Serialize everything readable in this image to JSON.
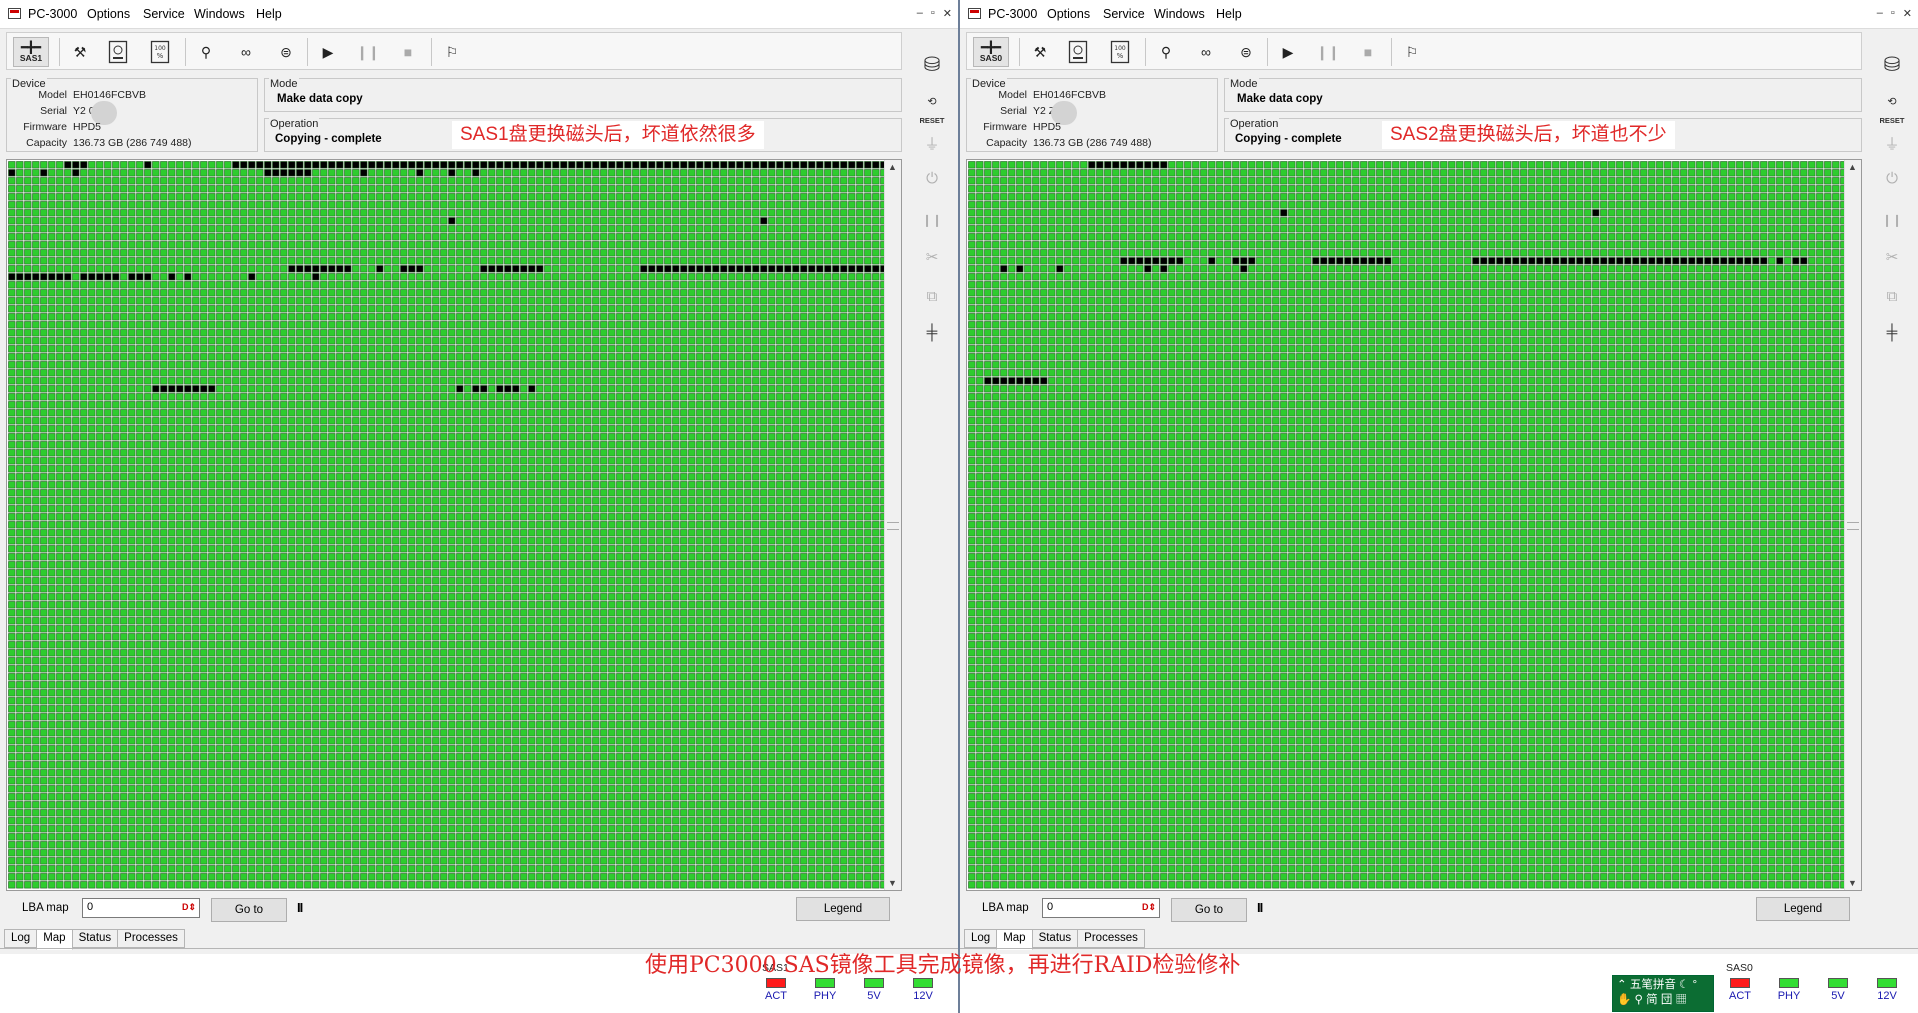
{
  "colors": {
    "ok_block": "#2ecc2e",
    "bad_block": "#000000",
    "annotation": "#e02828",
    "led_red": "#ff1a1a",
    "led_green": "#33dd33"
  },
  "panes": [
    {
      "menu": {
        "title": "PC-3000",
        "items": [
          "Options",
          "Service",
          "Windows",
          "Help"
        ]
      },
      "window_controls": [
        "–",
        "▫",
        "✕"
      ],
      "toolbar": {
        "device_tab": "SAS1",
        "icons": [
          "tools-icon",
          "hdd-info-icon",
          "percent-icon",
          "probe-icon",
          "binoculars-icon",
          "disk-copy-icon",
          "play-icon",
          "pause-icon",
          "stop-icon",
          "exit-icon"
        ]
      },
      "device": {
        "group_label": "Device",
        "model_label": "Model",
        "model": "EH0146FCBVB",
        "serial_label": "Serial",
        "serial": "Y2     0U",
        "firmware_label": "Firmware",
        "firmware": "HPD5",
        "capacity_label": "Capacity",
        "capacity": "136.73 GB (286 749 488)"
      },
      "mode": {
        "group_label": "Mode",
        "value": "Make data copy"
      },
      "operation": {
        "group_label": "Operation",
        "value": "Copying - complete"
      },
      "annotation": "SAS1盘更换磁头后，坏道依然很多",
      "map_bad_blocks": [
        [
          0,
          7
        ],
        [
          0,
          8
        ],
        [
          0,
          9
        ],
        [
          0,
          17
        ],
        [
          0,
          28
        ],
        [
          0,
          29
        ],
        [
          0,
          30
        ],
        [
          0,
          31
        ],
        [
          0,
          32
        ],
        [
          0,
          33
        ],
        [
          0,
          34
        ],
        [
          0,
          35
        ],
        [
          0,
          36
        ],
        [
          0,
          37
        ],
        [
          0,
          38
        ],
        [
          0,
          39
        ],
        [
          0,
          40
        ],
        [
          0,
          41
        ],
        [
          0,
          42
        ],
        [
          0,
          43
        ],
        [
          0,
          44
        ],
        [
          0,
          45
        ],
        [
          0,
          46
        ],
        [
          0,
          47
        ],
        [
          0,
          48
        ],
        [
          0,
          49
        ],
        [
          0,
          50
        ],
        [
          0,
          51
        ],
        [
          0,
          52
        ],
        [
          0,
          53
        ],
        [
          0,
          54
        ],
        [
          0,
          55
        ],
        [
          0,
          56
        ],
        [
          0,
          57
        ],
        [
          0,
          58
        ],
        [
          0,
          59
        ],
        [
          0,
          60
        ],
        [
          0,
          61
        ],
        [
          0,
          62
        ],
        [
          0,
          63
        ],
        [
          0,
          64
        ],
        [
          0,
          65
        ],
        [
          0,
          66
        ],
        [
          0,
          67
        ],
        [
          0,
          68
        ],
        [
          0,
          69
        ],
        [
          0,
          70
        ],
        [
          0,
          71
        ],
        [
          0,
          72
        ],
        [
          0,
          73
        ],
        [
          0,
          74
        ],
        [
          0,
          75
        ],
        [
          0,
          76
        ],
        [
          0,
          77
        ],
        [
          0,
          78
        ],
        [
          0,
          79
        ],
        [
          0,
          80
        ],
        [
          0,
          81
        ],
        [
          0,
          82
        ],
        [
          0,
          83
        ],
        [
          0,
          84
        ],
        [
          0,
          85
        ],
        [
          0,
          86
        ],
        [
          0,
          87
        ],
        [
          0,
          88
        ],
        [
          0,
          89
        ],
        [
          0,
          90
        ],
        [
          0,
          91
        ],
        [
          0,
          92
        ],
        [
          0,
          93
        ],
        [
          0,
          94
        ],
        [
          0,
          95
        ],
        [
          0,
          96
        ],
        [
          0,
          97
        ],
        [
          0,
          98
        ],
        [
          0,
          99
        ],
        [
          0,
          100
        ],
        [
          0,
          101
        ],
        [
          0,
          102
        ],
        [
          0,
          103
        ],
        [
          0,
          104
        ],
        [
          0,
          105
        ],
        [
          0,
          106
        ],
        [
          0,
          107
        ],
        [
          0,
          108
        ],
        [
          0,
          109
        ],
        [
          1,
          0
        ],
        [
          1,
          4
        ],
        [
          1,
          8
        ],
        [
          1,
          32
        ],
        [
          1,
          33
        ],
        [
          1,
          34
        ],
        [
          1,
          35
        ],
        [
          1,
          36
        ],
        [
          1,
          37
        ],
        [
          1,
          44
        ],
        [
          1,
          51
        ],
        [
          1,
          55
        ],
        [
          1,
          58
        ],
        [
          7,
          55
        ],
        [
          7,
          94
        ],
        [
          13,
          35
        ],
        [
          13,
          36
        ],
        [
          13,
          37
        ],
        [
          13,
          38
        ],
        [
          13,
          39
        ],
        [
          13,
          40
        ],
        [
          13,
          41
        ],
        [
          13,
          42
        ],
        [
          13,
          46
        ],
        [
          13,
          49
        ],
        [
          13,
          50
        ],
        [
          13,
          51
        ],
        [
          13,
          59
        ],
        [
          13,
          60
        ],
        [
          13,
          61
        ],
        [
          13,
          62
        ],
        [
          13,
          63
        ],
        [
          13,
          64
        ],
        [
          13,
          65
        ],
        [
          13,
          66
        ],
        [
          13,
          79
        ],
        [
          13,
          80
        ],
        [
          13,
          81
        ],
        [
          13,
          82
        ],
        [
          13,
          83
        ],
        [
          13,
          84
        ],
        [
          13,
          85
        ],
        [
          13,
          86
        ],
        [
          13,
          87
        ],
        [
          13,
          88
        ],
        [
          13,
          89
        ],
        [
          13,
          90
        ],
        [
          13,
          91
        ],
        [
          13,
          92
        ],
        [
          13,
          93
        ],
        [
          13,
          94
        ],
        [
          13,
          95
        ],
        [
          13,
          96
        ],
        [
          13,
          97
        ],
        [
          13,
          98
        ],
        [
          13,
          99
        ],
        [
          13,
          100
        ],
        [
          13,
          101
        ],
        [
          13,
          102
        ],
        [
          13,
          103
        ],
        [
          13,
          104
        ],
        [
          13,
          105
        ],
        [
          13,
          106
        ],
        [
          13,
          107
        ],
        [
          13,
          108
        ],
        [
          13,
          109
        ],
        [
          14,
          0
        ],
        [
          14,
          1
        ],
        [
          14,
          2
        ],
        [
          14,
          3
        ],
        [
          14,
          4
        ],
        [
          14,
          5
        ],
        [
          14,
          6
        ],
        [
          14,
          7
        ],
        [
          14,
          9
        ],
        [
          14,
          10
        ],
        [
          14,
          11
        ],
        [
          14,
          12
        ],
        [
          14,
          13
        ],
        [
          14,
          15
        ],
        [
          14,
          16
        ],
        [
          14,
          17
        ],
        [
          14,
          20
        ],
        [
          14,
          22
        ],
        [
          14,
          30
        ],
        [
          14,
          38
        ],
        [
          28,
          18
        ],
        [
          28,
          19
        ],
        [
          28,
          20
        ],
        [
          28,
          21
        ],
        [
          28,
          22
        ],
        [
          28,
          23
        ],
        [
          28,
          24
        ],
        [
          28,
          25
        ],
        [
          28,
          56
        ],
        [
          28,
          58
        ],
        [
          28,
          59
        ],
        [
          28,
          61
        ],
        [
          28,
          62
        ],
        [
          28,
          63
        ],
        [
          28,
          65
        ]
      ],
      "lba": {
        "label": "LBA map",
        "value": "0",
        "goto": "Go to",
        "pause": "II",
        "legend": "Legend"
      },
      "tabs": [
        "Log",
        "Map",
        "Status",
        "Processes"
      ],
      "active_tab": "Map",
      "sidebar": {
        "reset": "RESET"
      },
      "indicators": {
        "device": "SAS1",
        "leds": [
          {
            "label": "ACT",
            "color": "#ff1a1a"
          },
          {
            "label": "PHY",
            "color": "#33dd33"
          },
          {
            "label": "5V",
            "color": "#33dd33"
          },
          {
            "label": "12V",
            "color": "#33dd33"
          }
        ]
      }
    },
    {
      "menu": {
        "title": "PC-3000",
        "items": [
          "Options",
          "Service",
          "Windows",
          "Help"
        ]
      },
      "window_controls": [
        "–",
        "▫",
        "✕"
      ],
      "toolbar": {
        "device_tab": "SAS0",
        "icons": [
          "tools-icon",
          "hdd-info-icon",
          "percent-icon",
          "probe-icon",
          "binoculars-icon",
          "disk-copy-icon",
          "play-icon",
          "pause-icon",
          "stop-icon",
          "exit-icon"
        ]
      },
      "device": {
        "group_label": "Device",
        "model_label": "Model",
        "model": "EH0146FCBVB",
        "serial_label": "Serial",
        "serial": "Y2     Z",
        "firmware_label": "Firmware",
        "firmware": "HPD5",
        "capacity_label": "Capacity",
        "capacity": "136.73 GB (286 749 488)"
      },
      "mode": {
        "group_label": "Mode",
        "value": "Make data copy"
      },
      "operation": {
        "group_label": "Operation",
        "value": "Copying - complete"
      },
      "annotation": "SAS2盘更换磁头后，坏道也不少",
      "map_bad_blocks": [
        [
          0,
          15
        ],
        [
          0,
          16
        ],
        [
          0,
          17
        ],
        [
          0,
          18
        ],
        [
          0,
          19
        ],
        [
          0,
          20
        ],
        [
          0,
          21
        ],
        [
          0,
          22
        ],
        [
          0,
          23
        ],
        [
          0,
          24
        ],
        [
          6,
          39
        ],
        [
          6,
          78
        ],
        [
          12,
          19
        ],
        [
          12,
          20
        ],
        [
          12,
          21
        ],
        [
          12,
          22
        ],
        [
          12,
          23
        ],
        [
          12,
          24
        ],
        [
          12,
          25
        ],
        [
          12,
          26
        ],
        [
          12,
          30
        ],
        [
          12,
          33
        ],
        [
          12,
          34
        ],
        [
          12,
          35
        ],
        [
          12,
          43
        ],
        [
          12,
          44
        ],
        [
          12,
          45
        ],
        [
          12,
          46
        ],
        [
          12,
          47
        ],
        [
          12,
          48
        ],
        [
          12,
          49
        ],
        [
          12,
          50
        ],
        [
          12,
          51
        ],
        [
          12,
          52
        ],
        [
          12,
          63
        ],
        [
          12,
          64
        ],
        [
          12,
          65
        ],
        [
          12,
          66
        ],
        [
          12,
          67
        ],
        [
          12,
          68
        ],
        [
          12,
          69
        ],
        [
          12,
          70
        ],
        [
          12,
          71
        ],
        [
          12,
          72
        ],
        [
          12,
          73
        ],
        [
          12,
          74
        ],
        [
          12,
          75
        ],
        [
          12,
          76
        ],
        [
          12,
          77
        ],
        [
          12,
          78
        ],
        [
          12,
          79
        ],
        [
          12,
          80
        ],
        [
          12,
          81
        ],
        [
          12,
          82
        ],
        [
          12,
          83
        ],
        [
          12,
          84
        ],
        [
          12,
          85
        ],
        [
          12,
          86
        ],
        [
          12,
          87
        ],
        [
          12,
          88
        ],
        [
          12,
          89
        ],
        [
          12,
          90
        ],
        [
          12,
          91
        ],
        [
          12,
          92
        ],
        [
          12,
          93
        ],
        [
          12,
          94
        ],
        [
          12,
          95
        ],
        [
          12,
          96
        ],
        [
          12,
          97
        ],
        [
          12,
          98
        ],
        [
          12,
          99
        ],
        [
          12,
          101
        ],
        [
          12,
          103
        ],
        [
          12,
          104
        ],
        [
          13,
          4
        ],
        [
          13,
          6
        ],
        [
          13,
          11
        ],
        [
          13,
          22
        ],
        [
          13,
          24
        ],
        [
          13,
          34
        ],
        [
          27,
          2
        ],
        [
          27,
          3
        ],
        [
          27,
          4
        ],
        [
          27,
          5
        ],
        [
          27,
          6
        ],
        [
          27,
          7
        ],
        [
          27,
          8
        ],
        [
          27,
          9
        ]
      ],
      "lba": {
        "label": "LBA map",
        "value": "0",
        "goto": "Go to",
        "pause": "II",
        "legend": "Legend"
      },
      "tabs": [
        "Log",
        "Map",
        "Status",
        "Processes"
      ],
      "active_tab": "Map",
      "sidebar": {
        "reset": "RESET"
      },
      "indicators": {
        "device": "SAS0",
        "leds": [
          {
            "label": "ACT",
            "color": "#ff1a1a"
          },
          {
            "label": "PHY",
            "color": "#33dd33"
          },
          {
            "label": "5V",
            "color": "#33dd33"
          },
          {
            "label": "12V",
            "color": "#33dd33"
          }
        ]
      }
    }
  ],
  "caption": "使用PC3000 SAS镜像工具完成镜像，再进行RAID检验修补",
  "ime": {
    "row1": "五笔拼音",
    "row2": "简 団"
  }
}
